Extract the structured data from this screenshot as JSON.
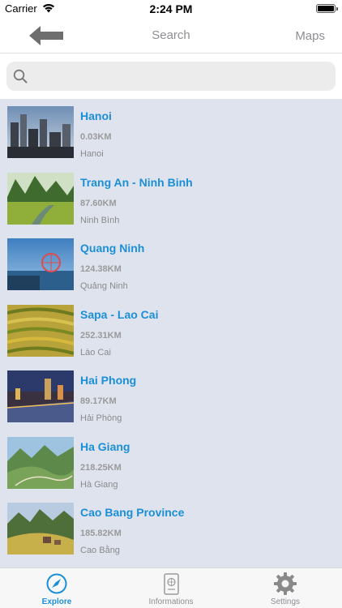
{
  "status_bar": {
    "carrier": "Carrier",
    "time": "2:24 PM"
  },
  "nav": {
    "title": "Search",
    "maps_label": "Maps",
    "back_icon": "back-arrow-icon"
  },
  "search": {
    "placeholder": "",
    "value": ""
  },
  "places": [
    {
      "name": "Hanoi",
      "distance": "0.03KM",
      "region": "Hanoi",
      "thumb": "city-skyline"
    },
    {
      "name": "Trang An - Ninh Binh",
      "distance": "87.60KM",
      "region": "Ninh Bình",
      "thumb": "green-karst-river"
    },
    {
      "name": "Quang Ninh",
      "distance": "124.38KM",
      "region": "Quảng Ninh",
      "thumb": "bay-ferris-wheel"
    },
    {
      "name": "Sapa - Lao Cai",
      "distance": "252.31KM",
      "region": "Lào Cai",
      "thumb": "rice-terraces"
    },
    {
      "name": "Hai Phong",
      "distance": "89.17KM",
      "region": "Hải Phòng",
      "thumb": "city-night"
    },
    {
      "name": "Ha Giang",
      "distance": "218.25KM",
      "region": "Hà Giang",
      "thumb": "mountain-valley"
    },
    {
      "name": "Cao Bang Province",
      "distance": "185.82KM",
      "region": "Cao Bằng",
      "thumb": "highland-village"
    }
  ],
  "tabs": [
    {
      "label": "Explore",
      "icon": "compass-icon",
      "active": true
    },
    {
      "label": "Informations",
      "icon": "passport-icon",
      "active": false
    },
    {
      "label": "Settings",
      "icon": "gear-icon",
      "active": false
    }
  ],
  "colors": {
    "accent": "#1b8fd6",
    "list_background": "#dfe3ee",
    "muted": "#8e8e93"
  }
}
